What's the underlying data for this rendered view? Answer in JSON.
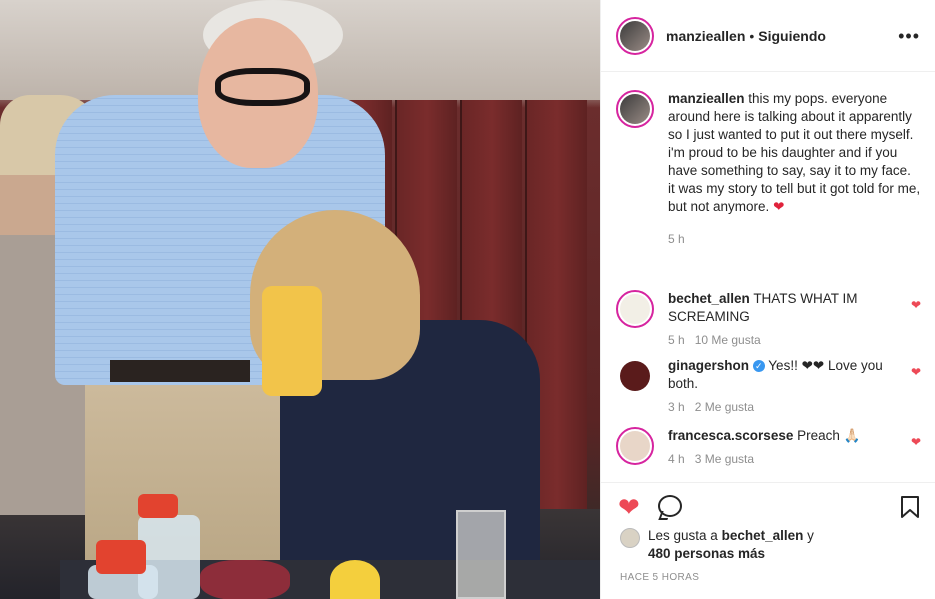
{
  "post": {
    "username": "manzieallen",
    "follow_state": "Siguiendo",
    "more_icon": "•••"
  },
  "caption": {
    "username": "manzieallen",
    "text": "this my pops. everyone around here is talking about it apparently so I just wanted to put it out there myself. i'm proud to be his daughter and if you have something to say, say it to my face. it was my story to tell but it got told for me, but not anymore.",
    "emoji": "❤",
    "time": "5 h"
  },
  "comments": [
    {
      "username": "bechet_allen",
      "text": "THATS WHAT IM SCREAMING",
      "time": "5 h",
      "likes": "10 Me gusta",
      "verified": false,
      "avatar_color": "#f2efe6"
    },
    {
      "username": "ginagershon",
      "text": "Yes!! ❤❤ Love you both.",
      "time": "3 h",
      "likes": "2 Me gusta",
      "verified": true,
      "avatar_color": "#5a1b1b"
    },
    {
      "username": "francesca.scorsese",
      "text": "Preach 🙏🏻",
      "time": "4 h",
      "likes": "3 Me gusta",
      "verified": false,
      "avatar_color": "#e8d6c8"
    }
  ],
  "likes": {
    "prefix": "Les gusta a",
    "user": "bechet_allen",
    "suffix": "y",
    "others": "480 personas más"
  },
  "posted_ago": "HACE 5 HORAS",
  "colors": {
    "like_red": "#ed4956",
    "text": "#262626",
    "muted": "#8e8e8e",
    "story_ring": "#d6249f"
  }
}
